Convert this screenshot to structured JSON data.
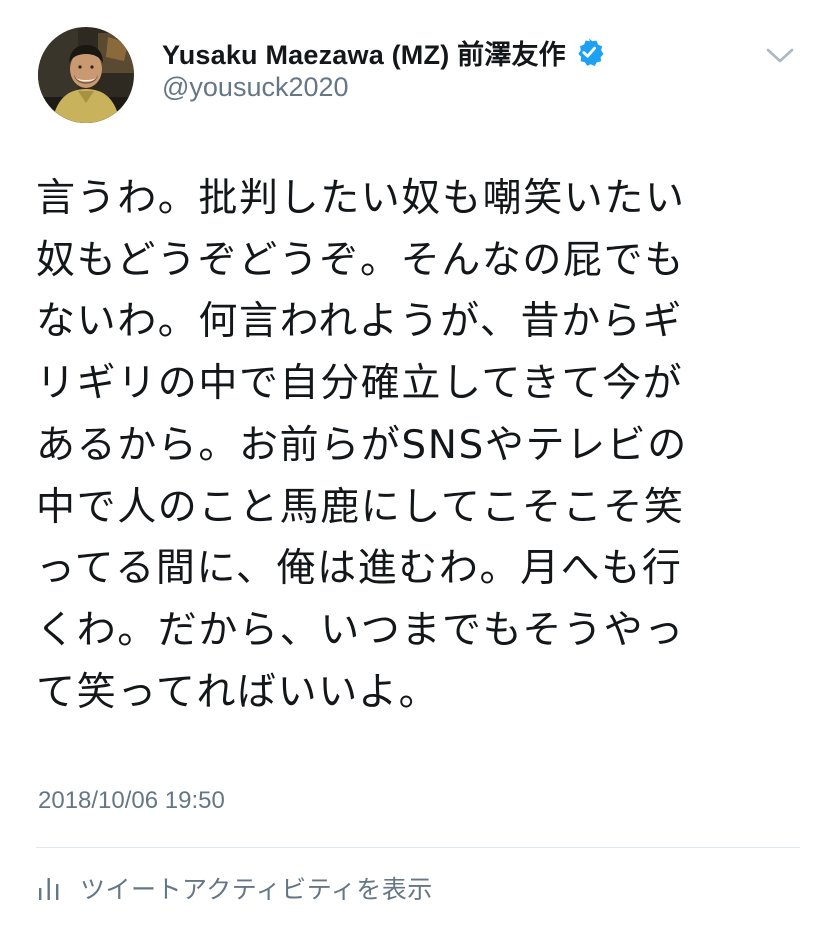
{
  "user": {
    "display_name": "Yusaku Maezawa (MZ) 前澤友作",
    "handle": "@yousuck2020",
    "verified_icon": "verified-badge-icon",
    "avatar_icon": "profile-photo"
  },
  "menu": {
    "icon": "chevron-down-icon"
  },
  "tweet": {
    "lines": [
      "言うわ。批判したい奴も嘲笑いたい",
      "奴もどうぞどうぞ。そんなの屁でも",
      "ないわ。何言われようが、昔からギ",
      "リギリの中で自分確立してきて今が",
      "あるから。お前らがSNSやテレビの",
      "中で人のこと馬鹿にしてこそこそ笑",
      "ってる間に、俺は進むわ。月へも行",
      "くわ。だから、いつまでもそうやっ",
      "て笑ってればいいよ。"
    ],
    "timestamp": "2018/10/06 19:50"
  },
  "footer": {
    "activity_icon": "bar-chart-icon",
    "activity_label": "ツイートアクティビティを表示"
  },
  "colors": {
    "text_primary": "#14171a",
    "text_secondary": "#657786",
    "verified_blue": "#1da1f2",
    "divider": "#e1e8ed"
  }
}
